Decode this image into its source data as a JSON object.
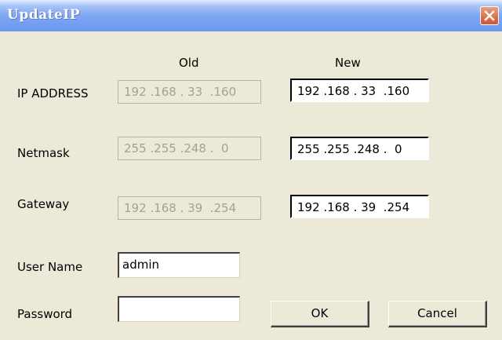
{
  "window": {
    "title": "UpdateIP"
  },
  "headers": {
    "old": "Old",
    "new": "New"
  },
  "rows": [
    {
      "label": "IP ADDRESS",
      "old": "192 .168 . 33  .160",
      "new": "192 .168 . 33  .160"
    },
    {
      "label": "Netmask",
      "old": "255 .255 .248 .  0",
      "new": "255 .255 .248 .  0"
    },
    {
      "label": "Gateway",
      "old": "192 .168 . 39  .254",
      "new": "192 .168 . 39  .254"
    }
  ],
  "user": {
    "label": "User Name",
    "value": "admin"
  },
  "password": {
    "label": "Password",
    "value": ""
  },
  "buttons": {
    "ok": "OK",
    "cancel": "Cancel"
  },
  "colors": {
    "title_bar": "#7ea6f2",
    "close_button": "#d0552c",
    "dialog_bg": "#ece9d8"
  },
  "icons": {
    "close": "close-icon"
  }
}
